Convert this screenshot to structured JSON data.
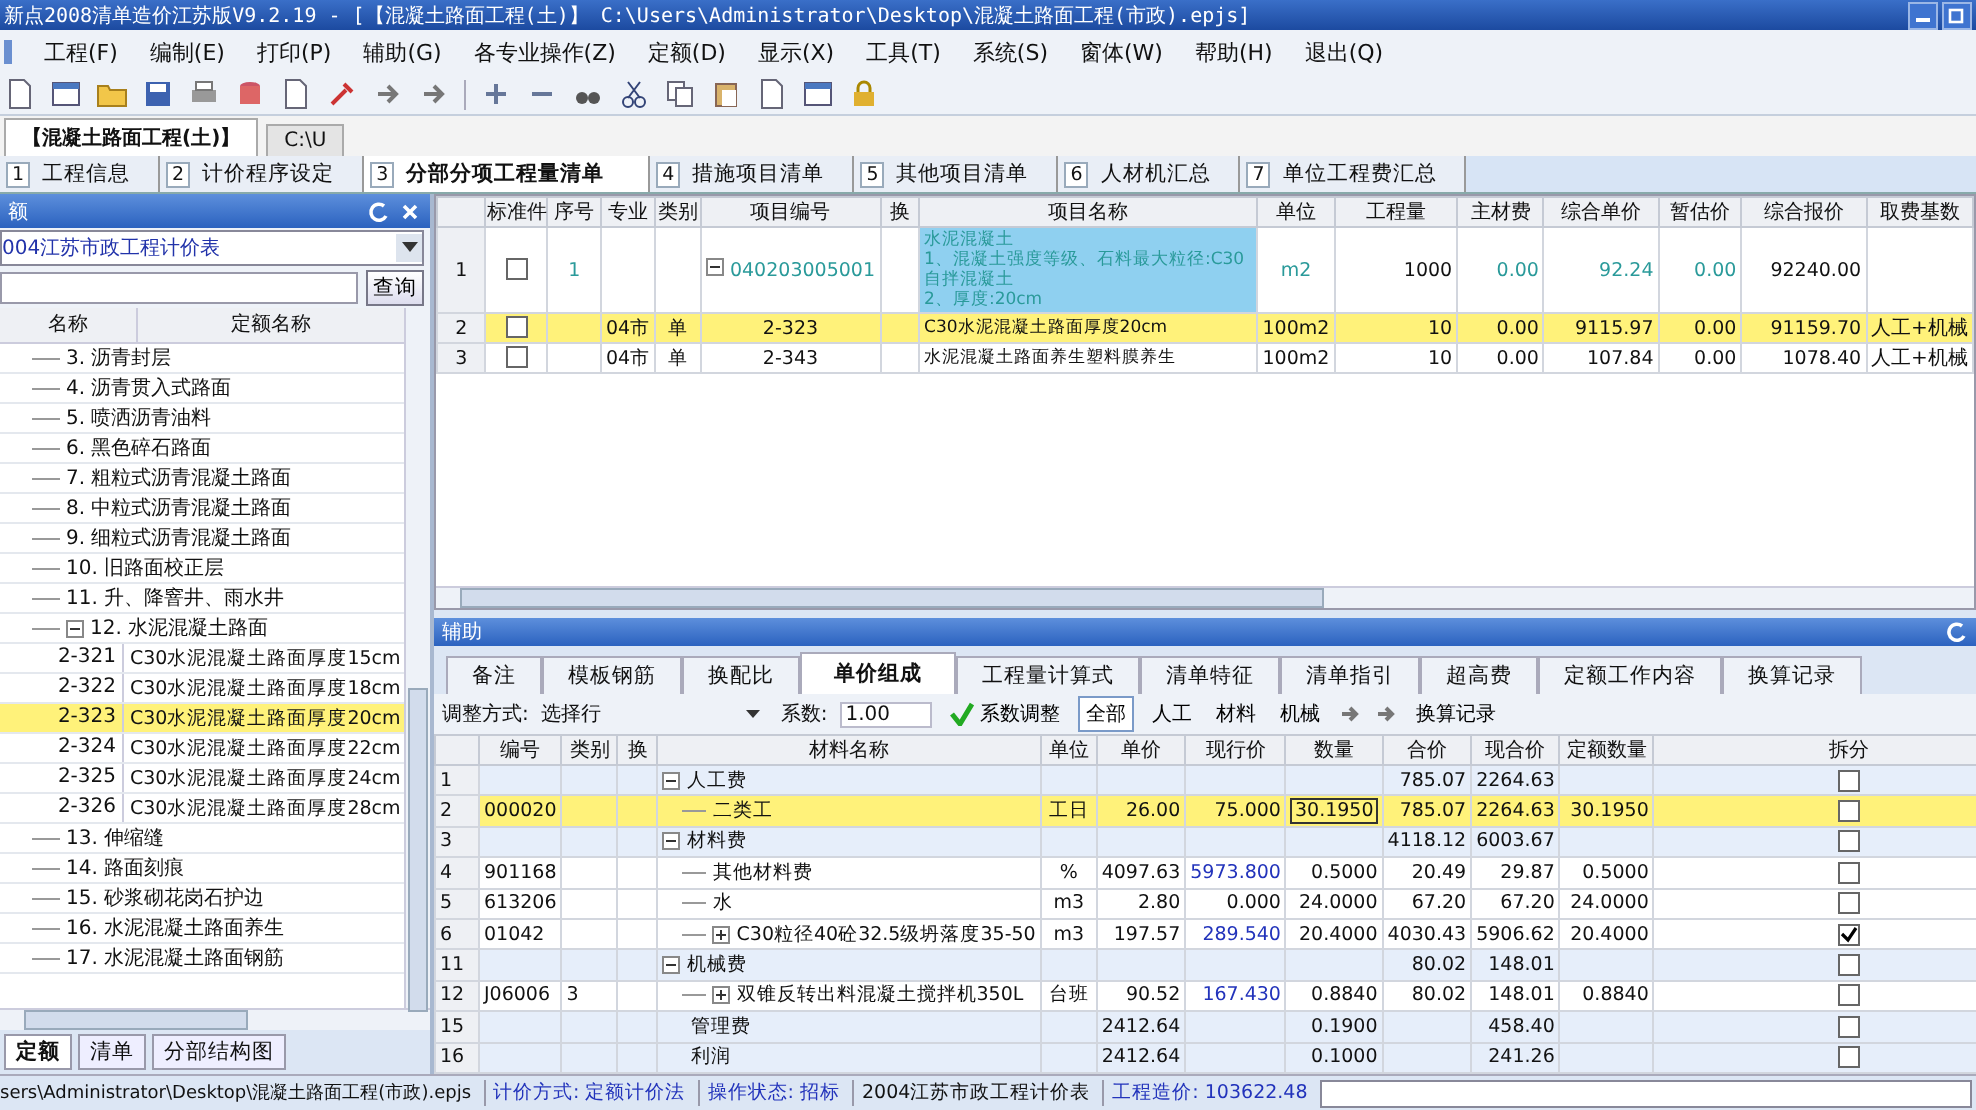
{
  "window": {
    "title": "新点2008清单造价江苏版V9.2.19 - [【混凝土路面工程(土)】   C:\\Users\\Administrator\\Desktop\\混凝土路面工程(市政).epjs]"
  },
  "menu": [
    "工程(F)",
    "编制(E)",
    "打印(P)",
    "辅助(G)",
    "各专业操作(Z)",
    "定额(D)",
    "显示(X)",
    "工具(T)",
    "系统(S)",
    "窗体(W)",
    "帮助(H)",
    "退出(Q)"
  ],
  "document_tabs": [
    {
      "label": "【混凝土路面工程(土)】",
      "selected": true
    },
    {
      "label": "C:\\U",
      "selected": false
    }
  ],
  "page_tabs": [
    {
      "number": "1",
      "label": "工程信息",
      "selected": false
    },
    {
      "number": "2",
      "label": "计价程序设定",
      "selected": false
    },
    {
      "number": "3",
      "label": "分部分项工程量清单",
      "selected": true
    },
    {
      "number": "4",
      "label": "措施项目清单",
      "selected": false
    },
    {
      "number": "5",
      "label": "其他项目清单",
      "selected": false
    },
    {
      "number": "6",
      "label": "人材机汇总",
      "selected": false
    },
    {
      "number": "7",
      "label": "单位工程费汇总",
      "selected": false
    }
  ],
  "left_panel": {
    "title": "额",
    "library": "004江苏市政工程计价表",
    "search_button": "查询",
    "columns": [
      "名称",
      "定额名称"
    ],
    "tree": [
      {
        "name": "3. 沥青封层",
        "selected": false
      },
      {
        "name": "4. 沥青贯入式路面",
        "selected": false
      },
      {
        "name": "5. 喷洒沥青油料",
        "selected": false
      },
      {
        "name": "6. 黑色碎石路面",
        "selected": false
      },
      {
        "name": "7. 粗粒式沥青混凝土路面",
        "selected": false
      },
      {
        "name": "8. 中粒式沥青混凝土路面",
        "selected": false
      },
      {
        "name": "9. 细粒式沥青混凝土路面",
        "selected": false
      },
      {
        "name": "10. 旧路面校正层",
        "selected": false
      },
      {
        "name": "11. 升、降窨井、雨水井",
        "selected": false
      },
      {
        "name": "12. 水泥混凝土路面",
        "selected": false,
        "expanded": true,
        "children": [
          {
            "code": "2-321",
            "name": "C30水泥混凝土路面厚度15cm",
            "selected": false
          },
          {
            "code": "2-322",
            "name": "C30水泥混凝土路面厚度18cm",
            "selected": false
          },
          {
            "code": "2-323",
            "name": "C30水泥混凝土路面厚度20cm",
            "selected": true
          },
          {
            "code": "2-324",
            "name": "C30水泥混凝土路面厚度22cm",
            "selected": false
          },
          {
            "code": "2-325",
            "name": "C30水泥混凝土路面厚度24cm",
            "selected": false
          },
          {
            "code": "2-326",
            "name": "C30水泥混凝土路面厚度28cm",
            "selected": false
          }
        ]
      },
      {
        "name": "13. 伸缩缝",
        "selected": false
      },
      {
        "name": "14. 路面刻痕",
        "selected": false
      },
      {
        "name": "15. 砂浆砌花岗石护边",
        "selected": false
      },
      {
        "name": "16. 水泥混凝土路面养生",
        "selected": false
      },
      {
        "name": "17. 水泥混凝土路面钢筋",
        "selected": false
      }
    ],
    "bottom_tabs": [
      {
        "label": "定额",
        "selected": true
      },
      {
        "label": "清单",
        "selected": false
      },
      {
        "label": "分部结构图",
        "selected": false
      }
    ]
  },
  "bill_table": {
    "columns": [
      "标准件",
      "序号",
      "专业",
      "类别",
      "项目编号",
      "换",
      "项目名称",
      "单位",
      "工程量",
      "主材费",
      "综合单价",
      "暂估价",
      "综合报价",
      "取费基数"
    ],
    "rows": [
      {
        "row": "1",
        "kind": "bill",
        "standard": false,
        "seq": "1",
        "code": "040203005001",
        "expanded": true,
        "name": "水泥混凝土\n1、混凝土强度等级、石料最大粒径:C30自拌混凝土\n2、厚度:20cm",
        "name_focused": true,
        "unit": "m2",
        "quantity": "1000",
        "material_fee": "0.00",
        "unit_price": "92.24",
        "provisional": "0.00",
        "total": "92240.00",
        "selected": false
      },
      {
        "row": "2",
        "kind": "quota",
        "standard": false,
        "specialty": "04市",
        "category": "单",
        "code": "2-323",
        "name": "C30水泥混凝土路面厚度20cm",
        "name_focused": false,
        "unit": "100m2",
        "quantity": "10",
        "material_fee": "0.00",
        "unit_price": "9115.97",
        "provisional": "0.00",
        "total": "91159.70",
        "fee_base": "人工+机械",
        "selected": true
      },
      {
        "row": "3",
        "kind": "quota",
        "standard": false,
        "specialty": "04市",
        "category": "单",
        "code": "2-343",
        "name": "水泥混凝土路面养生塑料膜养生",
        "name_focused": false,
        "unit": "100m2",
        "quantity": "10",
        "material_fee": "0.00",
        "unit_price": "107.84",
        "provisional": "0.00",
        "total": "1078.40",
        "fee_base": "人工+机械",
        "selected": false
      }
    ]
  },
  "assist_panel": {
    "title": "辅助",
    "tabs": [
      {
        "label": "备注",
        "selected": false
      },
      {
        "label": "模板钢筋",
        "selected": false
      },
      {
        "label": "换配比",
        "selected": false
      },
      {
        "label": "单价组成",
        "selected": true
      },
      {
        "label": "工程量计算式",
        "selected": false
      },
      {
        "label": "清单特征",
        "selected": false
      },
      {
        "label": "清单指引",
        "selected": false
      },
      {
        "label": "超高费",
        "selected": false
      },
      {
        "label": "定额工作内容",
        "selected": false
      },
      {
        "label": "换算记录",
        "selected": false
      }
    ],
    "toolbar": {
      "mode_label": "调整方式:",
      "mode_value": "选择行",
      "factor_label": "系数:",
      "factor_value": "1.00",
      "apply_button": "系数调整",
      "filters": [
        {
          "label": "全部",
          "selected": true
        },
        {
          "label": "人工",
          "selected": false
        },
        {
          "label": "材料",
          "selected": false
        },
        {
          "label": "机械",
          "selected": false
        }
      ],
      "record_button": "换算记录"
    },
    "columns": [
      "编号",
      "类别",
      "换",
      "材料名称",
      "单位",
      "单价",
      "现行价",
      "数量",
      "合价",
      "现合价",
      "定额数量",
      "拆分"
    ],
    "rows": [
      {
        "kind": "group",
        "row": "1",
        "name": "人工费",
        "expanded": true,
        "amount": "785.07",
        "current_amount": "2264.63",
        "split": false,
        "selected": false,
        "children": [
          {
            "kind": "item",
            "row": "2",
            "code": "000020",
            "name": "二类工",
            "unit": "工日",
            "price": "26.00",
            "current_price": "75.000",
            "price_changed": false,
            "quantity": "30.1950",
            "quantity_editing": true,
            "amount": "785.07",
            "current_amount": "2264.63",
            "quota_quantity": "30.1950",
            "split": false,
            "selected": true
          }
        ]
      },
      {
        "kind": "group",
        "row": "3",
        "name": "材料费",
        "expanded": true,
        "amount": "4118.12",
        "current_amount": "6003.67",
        "split": false,
        "selected": false,
        "children": [
          {
            "kind": "item",
            "row": "4",
            "code": "901168",
            "name": "其他材料费",
            "unit": "%",
            "price": "4097.63",
            "current_price": "5973.800",
            "price_changed": true,
            "quantity": "0.5000",
            "quantity_editing": false,
            "amount": "20.49",
            "current_amount": "29.87",
            "quota_quantity": "0.5000",
            "split": false,
            "selected": false
          },
          {
            "kind": "item",
            "row": "5",
            "code": "613206",
            "name": "水",
            "unit": "m3",
            "price": "2.80",
            "current_price": "0.000",
            "price_changed": false,
            "quantity": "24.0000",
            "quantity_editing": false,
            "amount": "67.20",
            "current_amount": "67.20",
            "quota_quantity": "24.0000",
            "split": false,
            "selected": false
          },
          {
            "kind": "item",
            "row": "6",
            "code": "01042",
            "name": "C30粒径40砼32.5级坍落度35-50",
            "expanded": false,
            "unit": "m3",
            "price": "197.57",
            "current_price": "289.540",
            "price_changed": true,
            "quantity": "20.4000",
            "quantity_editing": false,
            "amount": "4030.43",
            "current_amount": "5906.62",
            "quota_quantity": "20.4000",
            "split": true,
            "selected": false
          }
        ]
      },
      {
        "kind": "group",
        "row": "11",
        "name": "机械费",
        "expanded": true,
        "amount": "80.02",
        "current_amount": "148.01",
        "split": false,
        "selected": false,
        "children": [
          {
            "kind": "item",
            "row": "12",
            "code": "J06006",
            "category": "3",
            "name": "双锥反转出料混凝土搅拌机350L",
            "expanded": false,
            "unit": "台班",
            "price": "90.52",
            "current_price": "167.430",
            "price_changed": true,
            "quantity": "0.8840",
            "quantity_editing": false,
            "amount": "80.02",
            "current_amount": "148.01",
            "quota_quantity": "0.8840",
            "split": false,
            "selected": false
          }
        ]
      },
      {
        "kind": "fee",
        "row": "15",
        "name": "管理费",
        "price": "2412.64",
        "quantity": "0.1900",
        "current_amount": "458.40",
        "split": false,
        "selected": false
      },
      {
        "kind": "fee",
        "row": "16",
        "name": "利润",
        "price": "2412.64",
        "quantity": "0.1000",
        "current_amount": "241.26",
        "split": false,
        "selected": false
      }
    ]
  },
  "status_bar": {
    "path": "sers\\Administrator\\Desktop\\混凝土路面工程(市政).epjs",
    "fields": [
      {
        "text": "计价方式: 定额计价法",
        "highlight": true
      },
      {
        "text": "操作状态: 招标",
        "highlight": true
      },
      {
        "text": "2004江苏市政工程计价表",
        "highlight": false
      },
      {
        "text": "工程造价: 103622.48",
        "highlight": true
      }
    ]
  }
}
